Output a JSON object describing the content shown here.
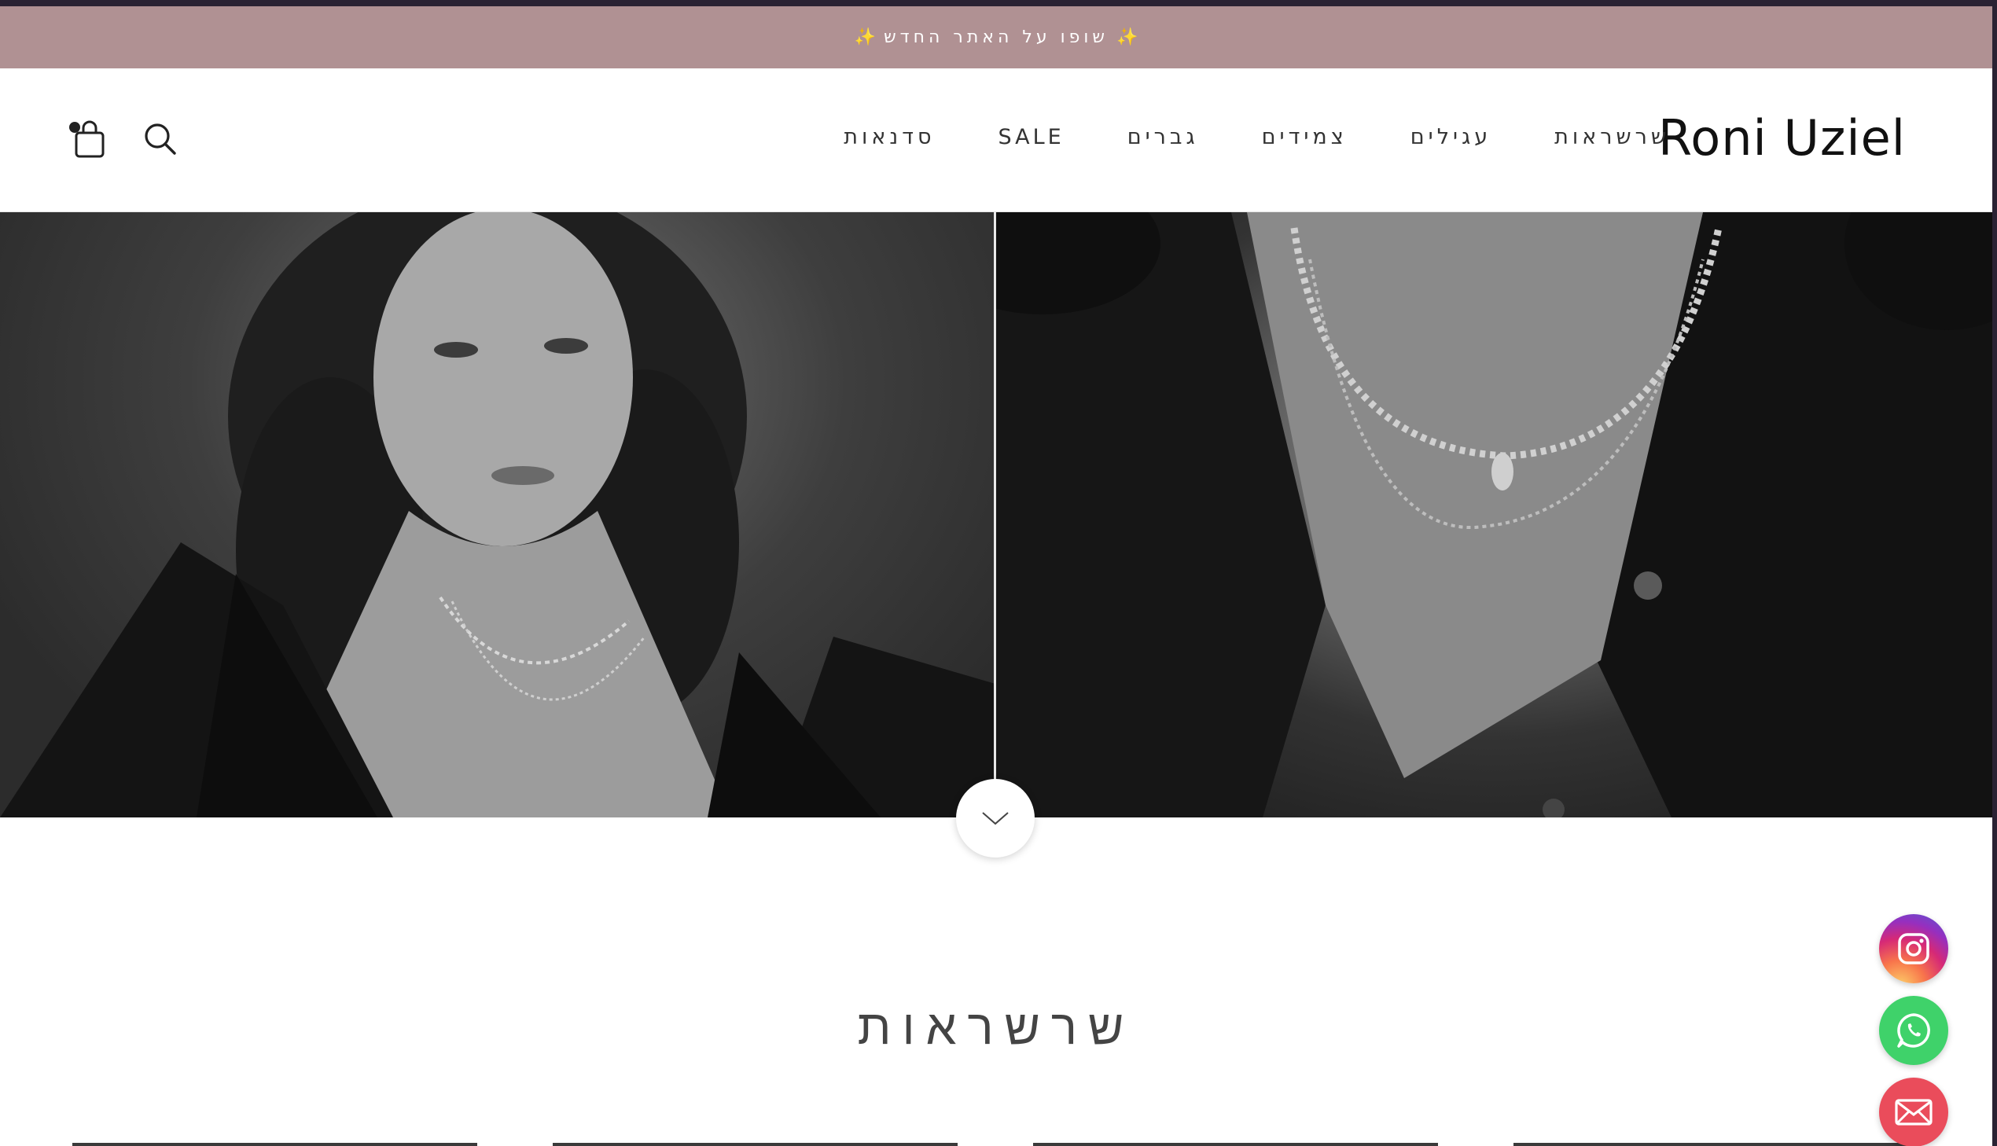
{
  "announcement": {
    "text": "שופו על האתר החדש",
    "sparkle": "✨"
  },
  "header": {
    "logo": "Roni Uziel",
    "nav": [
      {
        "label": "שרשראות"
      },
      {
        "label": "עגילים"
      },
      {
        "label": "צמידים"
      },
      {
        "label": "גברים"
      },
      {
        "label": "SALE"
      },
      {
        "label": "סדנאות"
      }
    ],
    "icons": {
      "search": "search-icon",
      "cart": "shopping-bag-icon"
    }
  },
  "hero": {
    "images": [
      "portrait-woman-necklace",
      "closeup-necklaces"
    ],
    "scroll_icon": "chevron-down-icon"
  },
  "section": {
    "title": "שרשראות"
  },
  "floating": {
    "instagram": "instagram-icon",
    "whatsapp": "whatsapp-icon",
    "email": "mail-icon",
    "colors": {
      "instagram": "#d62976",
      "whatsapp": "#3fd26a",
      "email": "#ea4c5b"
    }
  },
  "colors": {
    "announcement_bg": "#b09193",
    "header_bg": "#ffffff"
  }
}
